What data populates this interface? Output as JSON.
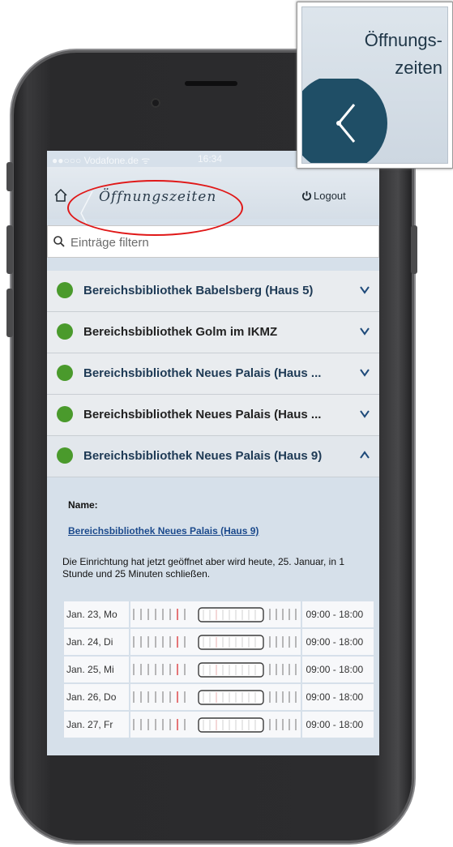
{
  "status_bar": {
    "carrier": "●●○○○ Vodafone.de ᯤ",
    "time": "16:34"
  },
  "header": {
    "title": "Öffnungszeiten",
    "logout_label": "Logout",
    "icons": [
      "home-icon",
      "power-icon"
    ]
  },
  "search": {
    "placeholder": "Einträge filtern"
  },
  "libraries": [
    {
      "name": "Bereichsbibliothek Babelsberg (Haus 5)",
      "status": "open",
      "expanded": false
    },
    {
      "name": "Bereichsbibliothek Golm im IKMZ",
      "status": "open",
      "expanded": false
    },
    {
      "name": "Bereichsbibliothek Neues Palais (Haus ...",
      "status": "open",
      "expanded": false
    },
    {
      "name": "Bereichsbibliothek Neues Palais (Haus ...",
      "status": "open",
      "expanded": false
    },
    {
      "name": "Bereichsbibliothek Neues Palais (Haus 9)",
      "status": "open",
      "expanded": true
    }
  ],
  "detail": {
    "name_label": "Name:",
    "name_link": "Bereichsbibliothek Neues Palais (Haus 9)",
    "status_text": "Die Einrichtung hat jetzt geöffnet aber wird heute, 25. Januar, in 1 Stunde und 25 Minuten schließen.",
    "hours": [
      {
        "day": "Jan. 23, Mo",
        "time": "09:00 - 18:00"
      },
      {
        "day": "Jan. 24, Di",
        "time": "09:00 - 18:00"
      },
      {
        "day": "Jan. 25, Mi",
        "time": "09:00 - 18:00"
      },
      {
        "day": "Jan. 26, Do",
        "time": "09:00 - 18:00"
      },
      {
        "day": "Jan. 27, Fr",
        "time": "09:00 - 18:00"
      }
    ]
  },
  "inset": {
    "line1": "Öffnungs-",
    "line2": "zeiten",
    "icon": "clock-icon"
  },
  "colors": {
    "open_dot": "#4a9a2c",
    "title_blue": "#1e3a55",
    "annotation_red": "#e01818",
    "screen_bg": "#d6e0ea"
  }
}
